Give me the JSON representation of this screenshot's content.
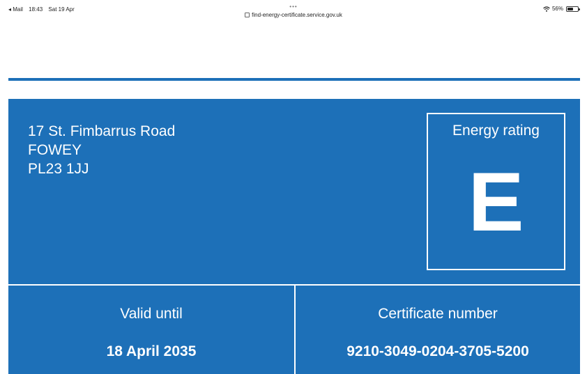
{
  "status_bar": {
    "back_app": "◂ Mail",
    "time": "18:43",
    "date": "Sat 19 Apr",
    "dots": "•••",
    "url": "find-energy-certificate.service.gov.uk",
    "battery": "56%",
    "battery_level": 0.56,
    "icons": [
      "wifi-icon",
      "battery-icon",
      "lock-icon"
    ]
  },
  "certificate": {
    "address_lines": [
      "17 St. Fimbarrus Road",
      "FOWEY",
      "PL23 1JJ"
    ],
    "rating_label": "Energy rating",
    "rating": "E",
    "valid_label": "Valid until",
    "valid_date": "18 April 2035",
    "number_label": "Certificate number",
    "number": "9210-3049-0204-3705-5200"
  },
  "colors": {
    "panel_blue": "#1d70b8",
    "text_white": "#ffffff"
  }
}
